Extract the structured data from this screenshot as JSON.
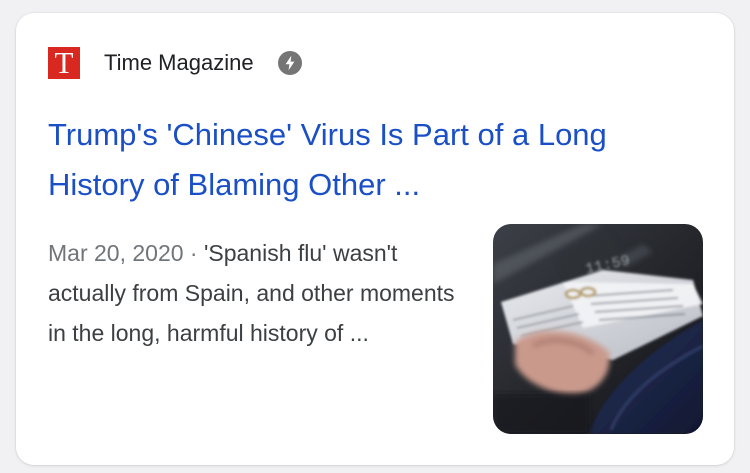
{
  "source": {
    "logo_letter": "T",
    "logo_color": "#d9281f",
    "name": "Time Magazine",
    "amp_icon": "amp-lightning-icon"
  },
  "result": {
    "title": "Trump's 'Chinese' Virus Is Part of a Long History of Blaming Other ...",
    "date": "Mar 20, 2020",
    "separator": " · ",
    "snippet": "'Spanish flu' wasn't actually from Spain, and other moments in the long, harmful history of ...",
    "thumbnail_text": "11:59",
    "link_color": "#1a4fc6"
  }
}
